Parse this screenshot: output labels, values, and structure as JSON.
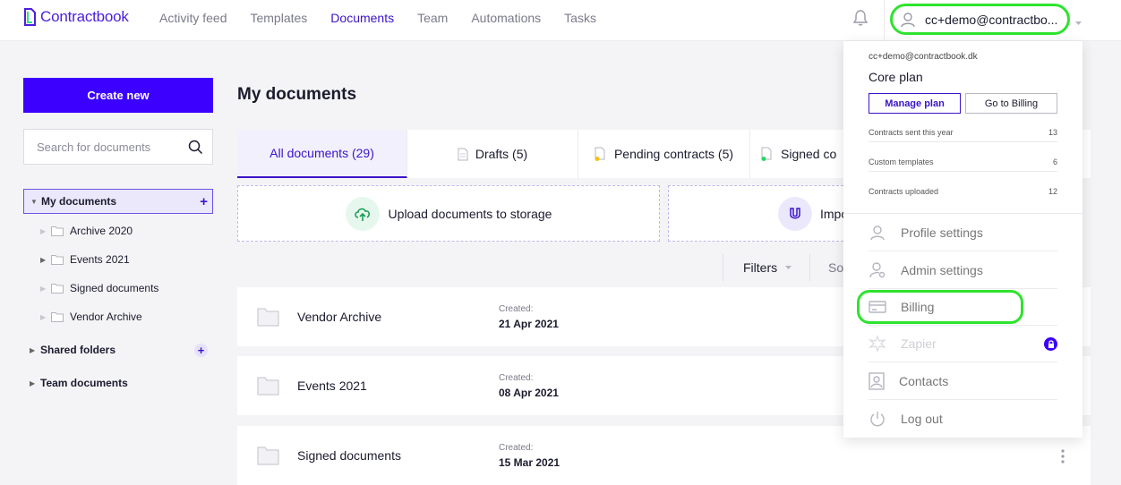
{
  "brand": {
    "name": "Contractbook",
    "color": "#4b1fdb"
  },
  "nav": {
    "items": [
      "Activity feed",
      "Templates",
      "Documents",
      "Team",
      "Automations",
      "Tasks"
    ],
    "active": "Documents"
  },
  "user": {
    "email": "cc+demo@contractbo..."
  },
  "sidebar": {
    "create_label": "Create new",
    "search_placeholder": "Search for documents",
    "tree": {
      "my_documents": "My documents",
      "children": [
        "Archive 2020",
        "Events 2021",
        "Signed documents",
        "Vendor Archive"
      ],
      "shared_folders": "Shared folders",
      "team_documents": "Team documents"
    }
  },
  "main": {
    "title": "My documents",
    "tabs": [
      {
        "label": "All documents (29)",
        "icon": "none"
      },
      {
        "label": "Drafts (5)",
        "icon": "document-icon"
      },
      {
        "label": "Pending contracts (5)",
        "icon": "pending-document-icon"
      },
      {
        "label": "Signed co",
        "icon": "signed-document-icon"
      }
    ],
    "upload_label": "Upload documents to storage",
    "import_label": "Impo",
    "filters_label": "Filters",
    "sort_label": "So",
    "documents": [
      {
        "name": "Vendor Archive",
        "created_label": "Created:",
        "created": "21 Apr 2021"
      },
      {
        "name": "Events 2021",
        "created_label": "Created:",
        "created": "08 Apr 2021"
      },
      {
        "name": "Signed documents",
        "created_label": "Created:",
        "created": "15 Mar 2021"
      }
    ]
  },
  "dropdown": {
    "email": "cc+demo@contractbook.dk",
    "plan": "Core plan",
    "manage_plan": "Manage plan",
    "go_to_billing": "Go to Billing",
    "stats": [
      {
        "label": "Contracts sent this year",
        "value": "13"
      },
      {
        "label": "Custom templates",
        "value": "6"
      },
      {
        "label": "Contracts uploaded",
        "value": "12"
      }
    ],
    "menu": [
      {
        "label": "Profile settings",
        "icon": "user-icon"
      },
      {
        "label": "Admin settings",
        "icon": "admin-gear-icon"
      },
      {
        "label": "Billing",
        "icon": "credit-card-icon"
      },
      {
        "label": "Zapier",
        "icon": "zapier-icon",
        "locked": true
      },
      {
        "label": "Contacts",
        "icon": "contacts-icon"
      },
      {
        "label": "Log out",
        "icon": "power-icon"
      }
    ]
  },
  "colors": {
    "primary": "#3b00ff",
    "highlight": "#2ee32e",
    "accent_text": "#3b14c9"
  }
}
